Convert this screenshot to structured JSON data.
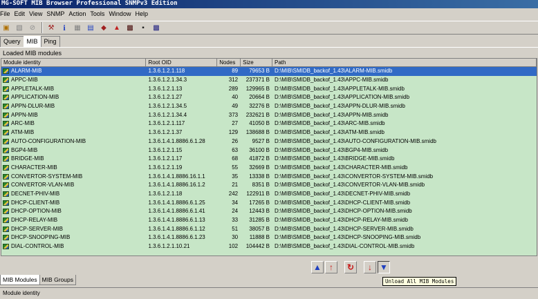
{
  "window": {
    "title": "MG-SOFT MIB Browser Professional SNMPv3 Edition"
  },
  "menu": [
    {
      "label": "File"
    },
    {
      "label": "Edit"
    },
    {
      "label": "View"
    },
    {
      "label": "SNMP"
    },
    {
      "label": "Action"
    },
    {
      "label": "Tools"
    },
    {
      "label": "Window"
    },
    {
      "label": "Help"
    }
  ],
  "toolbar": {
    "icons": [
      "connect-icon",
      "query-icon",
      "stop-icon",
      "tools-icon",
      "info-icon",
      "table-icon",
      "chart-icon",
      "find-icon",
      "trap-icon",
      "config-icon",
      "graph-icon",
      "mib-icon"
    ]
  },
  "top_tabs": [
    {
      "label": "Query"
    },
    {
      "label": "MIB"
    },
    {
      "label": "Ping"
    }
  ],
  "panel": {
    "label": "Loaded MIB modules"
  },
  "table": {
    "columns": [
      "Module identity",
      "Root OID",
      "Nodes",
      "Size",
      "Path"
    ],
    "rows": [
      {
        "name": "ALARM-MIB",
        "oid": "1.3.6.1.2.1.118",
        "nodes": "89",
        "size": "79653 B",
        "path": "D:\\MIB\\SMIDB_backof_1.43\\ALARM-MIB.smidb"
      },
      {
        "name": "APPC-MIB",
        "oid": "1.3.6.1.2.1.34.3",
        "nodes": "312",
        "size": "237371 B",
        "path": "D:\\MIB\\SMIDB_backof_1.43\\APPC-MIB.smidb"
      },
      {
        "name": "APPLETALK-MIB",
        "oid": "1.3.6.1.2.1.13",
        "nodes": "289",
        "size": "129965 B",
        "path": "D:\\MIB\\SMIDB_backof_1.43\\APPLETALK-MIB.smidb"
      },
      {
        "name": "APPLICATION-MIB",
        "oid": "1.3.6.1.2.1.27",
        "nodes": "40",
        "size": "20664 B",
        "path": "D:\\MIB\\SMIDB_backof_1.43\\APPLICATION-MIB.smidb"
      },
      {
        "name": "APPN-DLUR-MIB",
        "oid": "1.3.6.1.2.1.34.5",
        "nodes": "49",
        "size": "32276 B",
        "path": "D:\\MIB\\SMIDB_backof_1.43\\APPN-DLUR-MIB.smidb"
      },
      {
        "name": "APPN-MIB",
        "oid": "1.3.6.1.2.1.34.4",
        "nodes": "373",
        "size": "232621 B",
        "path": "D:\\MIB\\SMIDB_backof_1.43\\APPN-MIB.smidb"
      },
      {
        "name": "ARC-MIB",
        "oid": "1.3.6.1.2.1.117",
        "nodes": "27",
        "size": "41050 B",
        "path": "D:\\MIB\\SMIDB_backof_1.43\\ARC-MIB.smidb"
      },
      {
        "name": "ATM-MIB",
        "oid": "1.3.6.1.2.1.37",
        "nodes": "129",
        "size": "138688 B",
        "path": "D:\\MIB\\SMIDB_backof_1.43\\ATM-MIB.smidb"
      },
      {
        "name": "AUTO-CONFIGURATION-MIB",
        "oid": "1.3.6.1.4.1.8886.6.1.28",
        "nodes": "26",
        "size": "9527 B",
        "path": "D:\\MIB\\SMIDB_backof_1.43\\AUTO-CONFIGURATION-MIB.smidb"
      },
      {
        "name": "BGP4-MIB",
        "oid": "1.3.6.1.2.1.15",
        "nodes": "63",
        "size": "36100 B",
        "path": "D:\\MIB\\SMIDB_backof_1.43\\BGP4-MIB.smidb"
      },
      {
        "name": "BRIDGE-MIB",
        "oid": "1.3.6.1.2.1.17",
        "nodes": "68",
        "size": "41872 B",
        "path": "D:\\MIB\\SMIDB_backof_1.43\\BRIDGE-MIB.smidb"
      },
      {
        "name": "CHARACTER-MIB",
        "oid": "1.3.6.1.2.1.19",
        "nodes": "55",
        "size": "32669 B",
        "path": "D:\\MIB\\SMIDB_backof_1.43\\CHARACTER-MIB.smidb"
      },
      {
        "name": "CONVERTOR-SYSTEM-MIB",
        "oid": "1.3.6.1.4.1.8886.16.1.1",
        "nodes": "35",
        "size": "13338 B",
        "path": "D:\\MIB\\SMIDB_backof_1.43\\CONVERTOR-SYSTEM-MIB.smidb"
      },
      {
        "name": "CONVERTOR-VLAN-MIB",
        "oid": "1.3.6.1.4.1.8886.16.1.2",
        "nodes": "21",
        "size": "8351 B",
        "path": "D:\\MIB\\SMIDB_backof_1.43\\CONVERTOR-VLAN-MIB.smidb"
      },
      {
        "name": "DECNET-PHIV-MIB",
        "oid": "1.3.6.1.2.1.18",
        "nodes": "242",
        "size": "122911 B",
        "path": "D:\\MIB\\SMIDB_backof_1.43\\DECNET-PHIV-MIB.smidb"
      },
      {
        "name": "DHCP-CLIENT-MIB",
        "oid": "1.3.6.1.4.1.8886.6.1.25",
        "nodes": "34",
        "size": "17265 B",
        "path": "D:\\MIB\\SMIDB_backof_1.43\\DHCP-CLIENT-MIB.smidb"
      },
      {
        "name": "DHCP-OPTION-MIB",
        "oid": "1.3.6.1.4.1.8886.6.1.41",
        "nodes": "24",
        "size": "12443 B",
        "path": "D:\\MIB\\SMIDB_backof_1.43\\DHCP-OPTION-MIB.smidb"
      },
      {
        "name": "DHCP-RELAY-MIB",
        "oid": "1.3.6.1.4.1.8886.6.1.13",
        "nodes": "33",
        "size": "31285 B",
        "path": "D:\\MIB\\SMIDB_backof_1.43\\DHCP-RELAY-MIB.smidb"
      },
      {
        "name": "DHCP-SERVER-MIB",
        "oid": "1.3.6.1.4.1.8886.6.1.12",
        "nodes": "51",
        "size": "38057 B",
        "path": "D:\\MIB\\SMIDB_backof_1.43\\DHCP-SERVER-MIB.smidb"
      },
      {
        "name": "DHCP-SNOOPING-MIB",
        "oid": "1.3.6.1.4.1.8886.6.1.23",
        "nodes": "30",
        "size": "11888 B",
        "path": "D:\\MIB\\SMIDB_backof_1.43\\DHCP-SNOOPING-MIB.smidb"
      },
      {
        "name": "DIAL-CONTROL-MIB",
        "oid": "1.3.6.1.2.1.10.21",
        "nodes": "102",
        "size": "104442 B",
        "path": "D:\\MIB\\SMIDB_backof_1.43\\DIAL-CONTROL-MIB.smidb"
      }
    ]
  },
  "action_buttons": [
    "load-up",
    "load-down",
    "reload",
    "unload-one",
    "unload-all"
  ],
  "tooltip": {
    "text": "Unload All MIB Modules"
  },
  "bottom_tabs": [
    {
      "label": "MIB Modules"
    },
    {
      "label": "MIB Groups"
    }
  ],
  "status": {
    "text": "Module identity"
  }
}
